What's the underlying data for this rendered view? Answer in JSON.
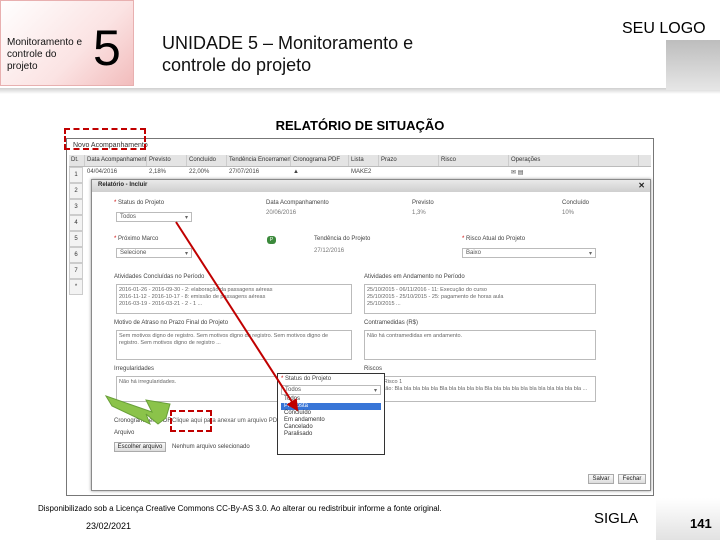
{
  "header": {
    "badge_text": "Monitoramento e controle do projeto",
    "badge_number": "5",
    "title": "UNIDADE 5 – Monitoramento e controle do projeto",
    "logo": "SEU LOGO"
  },
  "section_title": "RELATÓRIO DE SITUAÇÃO",
  "screenshot": {
    "add_link": "Novo Acompanhamento",
    "columns": [
      "Dt.",
      "Data Acompanhamento",
      "Previsto",
      "Concluído",
      "Tendência Encerramento",
      "Cronograma PDF",
      "Lista",
      "Prazo",
      "Risco",
      "Operações"
    ],
    "row_numbers": [
      "1",
      "2",
      "3",
      "4",
      "5",
      "6",
      "7",
      "*"
    ],
    "first_row": [
      "04/04/2016",
      "2,18%",
      "22,00%",
      "27/07/2016",
      "▲",
      "MAKE2",
      "",
      "",
      "✉ ▤"
    ],
    "modal": {
      "title": "Relatório - Incluir",
      "close": "✕",
      "status_label": "Status do Projeto",
      "status_value": "Todos",
      "date_label": "Data Acompanhamento",
      "date_value": "20/06/2016",
      "previsto_label": "Previsto",
      "previsto_value": "1,3%",
      "concluido_label": "Concluído",
      "concluido_value": "10%",
      "marco_label": "Próximo Marco",
      "marco_value": "Selecione",
      "tendencia_label": "Tendência do Projeto",
      "tendencia_value": "27/12/2016",
      "risco_label": "Risco Atual do Projeto",
      "risco_value": "Baixo",
      "atividades_label": "Atividades Concluídas no Período",
      "atividades_text": "2016-01-26 - 2016-09-30 - 2: elaboração da passagens aéreas\n2016-11-12 - 2016-10-17 - 8: emissão de passagens aéreas\n2016-03-19 - 2016-03-21 - 2 - 1 ...",
      "andamento_label": "Atividades em Andamento no Período",
      "andamento_text": "25/10/2015 - 06/11/2016 - 11: Execução do curso\n25/10/2015 - 25/10/2015 - 25: pagamento de horas aula\n25/10/2015 ...",
      "motivo_label": "Motivo de Atraso no Prazo Final do Projeto",
      "motivo_text": "Sem motivos digno de registro. Sem motivos digno de registro. Sem motivos digno de registro. Sem motivos digno de registro ...",
      "contramedidas_label": "Contramedidas (R$)",
      "contramedidas_text": "Não há contramedidas em andamento.",
      "irregularidades_label": "Irregularidades",
      "irregularidades_text": "Não há irregularidades.",
      "riscos_label": "Riscos",
      "riscos_text": "Título: Risco 1\nDescrição: Bla bla bla bla bla Bla bla bla bla bla Bla bla bla bla bla bla bla bla bla bla bla ...",
      "cronograma_label": "Cronograma em PDF",
      "cronograma_hint": "Clique aqui para anexar um arquivo PDF do cronograma",
      "arquivo_label": "Arquivo",
      "choose_button": "Escolher arquivo",
      "no_file": "Nenhum arquivo selecionado",
      "status_projeto_label": "Status do Projeto",
      "status_projeto_value": "Todos",
      "status_options": [
        "Todos",
        "Proposta",
        "Concluído",
        "Em andamento",
        "Cancelado",
        "Paralisado"
      ],
      "status_selected_index": 1,
      "save_button": "Salvar",
      "close_button": "Fechar"
    }
  },
  "footer": {
    "license": "Disponibilizado sob a Licença Creative Commons CC-By-AS 3.0. Ao alterar ou redistribuir informe a fonte original.",
    "date": "23/02/2021",
    "sigla": "SIGLA",
    "page": "141"
  },
  "colors": {
    "annotation_red": "#c00000",
    "arrow_green": "#7cb342",
    "selection_blue": "#3875d7"
  }
}
